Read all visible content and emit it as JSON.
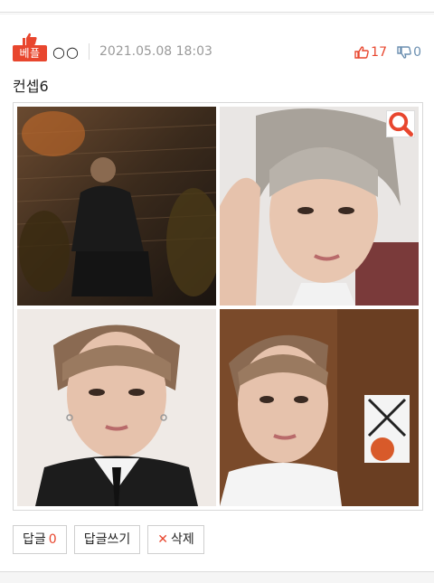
{
  "post": {
    "badge_label": "베플",
    "author": "○○",
    "date": "2021.05.08 18:03",
    "likes": "17",
    "dislikes": "0",
    "title": "컨셉6"
  },
  "gallery": {
    "images": [
      {
        "alt": "photo-1"
      },
      {
        "alt": "photo-2"
      },
      {
        "alt": "photo-3"
      },
      {
        "alt": "photo-4"
      }
    ]
  },
  "actions": {
    "reply_label": "답글",
    "reply_count": "0",
    "write_reply_label": "답글쓰기",
    "delete_label": "삭제"
  },
  "colors": {
    "accent": "#e8462e",
    "dislike": "#6b8fb0"
  }
}
